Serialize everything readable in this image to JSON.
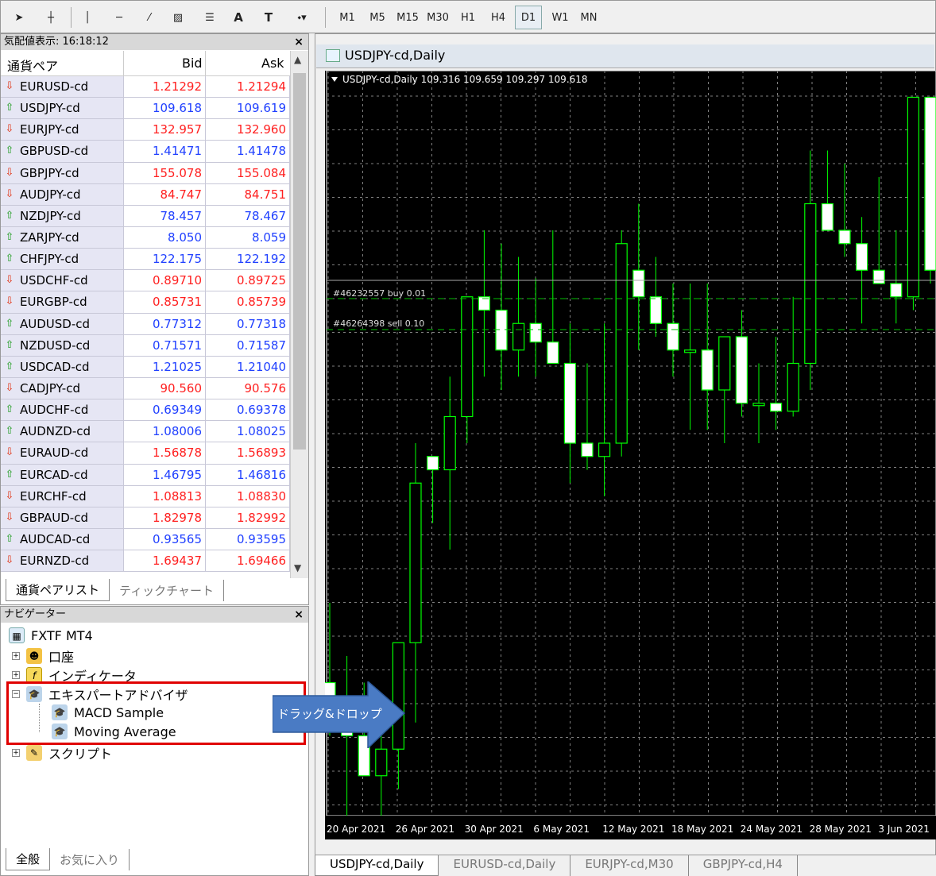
{
  "toolbar": {
    "items": [
      {
        "kind": "icon",
        "name": "cursor-icon",
        "glyph": "➤"
      },
      {
        "kind": "icon",
        "name": "crosshair-icon",
        "glyph": "┼"
      },
      {
        "kind": "icon",
        "name": "vertical-line-icon",
        "glyph": "│"
      },
      {
        "kind": "icon",
        "name": "horizontal-line-icon",
        "glyph": "─"
      },
      {
        "kind": "icon",
        "name": "trendline-icon",
        "glyph": "⁄"
      },
      {
        "kind": "icon",
        "name": "equidistant-channel-icon",
        "glyph": "▨"
      },
      {
        "kind": "icon",
        "name": "fibonacci-icon",
        "glyph": "☰"
      },
      {
        "kind": "text",
        "name": "text-tool-icon",
        "glyph": "A"
      },
      {
        "kind": "text",
        "name": "text-label-icon",
        "glyph": "T"
      },
      {
        "kind": "icon",
        "name": "arrows-dropdown-icon",
        "glyph": "⬩▾"
      }
    ],
    "periods": [
      "M1",
      "M5",
      "M15",
      "M30",
      "H1",
      "H4",
      "D1",
      "W1",
      "MN"
    ],
    "active_period": "D1"
  },
  "market_watch": {
    "title": "気配値表示: 16:18:12",
    "close": "×",
    "col_symbol": "通貨ペア",
    "col_bid": "Bid",
    "col_ask": "Ask",
    "rows": [
      {
        "s": "EURUSD-cd",
        "b": "1.21292",
        "a": "1.21294",
        "dir": "dn",
        "c": "red"
      },
      {
        "s": "USDJPY-cd",
        "b": "109.618",
        "a": "109.619",
        "dir": "up",
        "c": "blue"
      },
      {
        "s": "EURJPY-cd",
        "b": "132.957",
        "a": "132.960",
        "dir": "dn",
        "c": "red"
      },
      {
        "s": "GBPUSD-cd",
        "b": "1.41471",
        "a": "1.41478",
        "dir": "up",
        "c": "blue"
      },
      {
        "s": "GBPJPY-cd",
        "b": "155.078",
        "a": "155.084",
        "dir": "dn",
        "c": "red"
      },
      {
        "s": "AUDJPY-cd",
        "b": "84.747",
        "a": "84.751",
        "dir": "dn",
        "c": "red"
      },
      {
        "s": "NZDJPY-cd",
        "b": "78.457",
        "a": "78.467",
        "dir": "up",
        "c": "blue"
      },
      {
        "s": "ZARJPY-cd",
        "b": "8.050",
        "a": "8.059",
        "dir": "up",
        "c": "blue"
      },
      {
        "s": "CHFJPY-cd",
        "b": "122.175",
        "a": "122.192",
        "dir": "up",
        "c": "blue"
      },
      {
        "s": "USDCHF-cd",
        "b": "0.89710",
        "a": "0.89725",
        "dir": "dn",
        "c": "red"
      },
      {
        "s": "EURGBP-cd",
        "b": "0.85731",
        "a": "0.85739",
        "dir": "dn",
        "c": "red"
      },
      {
        "s": "AUDUSD-cd",
        "b": "0.77312",
        "a": "0.77318",
        "dir": "up",
        "c": "blue"
      },
      {
        "s": "NZDUSD-cd",
        "b": "0.71571",
        "a": "0.71587",
        "dir": "up",
        "c": "blue"
      },
      {
        "s": "USDCAD-cd",
        "b": "1.21025",
        "a": "1.21040",
        "dir": "up",
        "c": "blue"
      },
      {
        "s": "CADJPY-cd",
        "b": "90.560",
        "a": "90.576",
        "dir": "dn",
        "c": "red"
      },
      {
        "s": "AUDCHF-cd",
        "b": "0.69349",
        "a": "0.69378",
        "dir": "up",
        "c": "blue"
      },
      {
        "s": "AUDNZD-cd",
        "b": "1.08006",
        "a": "1.08025",
        "dir": "up",
        "c": "blue"
      },
      {
        "s": "EURAUD-cd",
        "b": "1.56878",
        "a": "1.56893",
        "dir": "dn",
        "c": "red"
      },
      {
        "s": "EURCAD-cd",
        "b": "1.46795",
        "a": "1.46816",
        "dir": "up",
        "c": "blue"
      },
      {
        "s": "EURCHF-cd",
        "b": "1.08813",
        "a": "1.08830",
        "dir": "dn",
        "c": "red"
      },
      {
        "s": "GBPAUD-cd",
        "b": "1.82978",
        "a": "1.82992",
        "dir": "dn",
        "c": "red"
      },
      {
        "s": "AUDCAD-cd",
        "b": "0.93565",
        "a": "0.93595",
        "dir": "up",
        "c": "blue"
      },
      {
        "s": "EURNZD-cd",
        "b": "1.69437",
        "a": "1.69466",
        "dir": "dn",
        "c": "red"
      }
    ],
    "tab_active": "通貨ペアリスト",
    "tab_other": "ティックチャート"
  },
  "navigator": {
    "title": "ナビゲーター",
    "close": "×",
    "root": "FXTF MT4",
    "account": "口座",
    "indicators": "インディケータ",
    "experts": "エキスパートアドバイザ",
    "ea1": "MACD Sample",
    "ea2": "Moving Average",
    "scripts": "スクリプト",
    "tab_active": "全般",
    "tab_other": "お気に入り"
  },
  "annotation": {
    "dnd_label": "ドラッグ&ドロップ"
  },
  "chart_window": {
    "title": "USDJPY-cd,Daily",
    "info_symbol": "USDJPY-cd,Daily",
    "info_ohlc": "109.316 109.659 109.297 109.618",
    "order1": "#46232557 buy 0.01",
    "order2": "#46264398 sell 0.10"
  },
  "chart_data": {
    "type": "candlestick",
    "dates": [
      "20 Apr 2021",
      "26 Apr 2021",
      "30 Apr 2021",
      "6 May 2021",
      "12 May 2021",
      "18 May 2021",
      "24 May 2021",
      "28 May 2021",
      "3 Jun 2021"
    ],
    "ylim": [
      107.6,
      110.4
    ],
    "candles": [
      [
        108.1,
        108.4,
        107.9,
        107.95
      ],
      [
        107.95,
        108.2,
        107.6,
        107.9
      ],
      [
        107.9,
        108.1,
        107.75,
        107.75
      ],
      [
        107.75,
        108.0,
        107.4,
        107.85
      ],
      [
        107.85,
        108.2,
        107.7,
        108.25
      ],
      [
        108.25,
        109.0,
        107.95,
        108.85
      ],
      [
        108.95,
        108.9,
        108.7,
        108.9
      ],
      [
        108.9,
        109.25,
        108.6,
        109.1
      ],
      [
        109.1,
        109.55,
        109.0,
        109.55
      ],
      [
        109.55,
        109.8,
        109.25,
        109.5
      ],
      [
        109.5,
        109.75,
        109.2,
        109.35
      ],
      [
        109.35,
        109.7,
        109.25,
        109.45
      ],
      [
        109.45,
        109.62,
        109.25,
        109.38
      ],
      [
        109.38,
        109.8,
        109.3,
        109.3
      ],
      [
        109.3,
        109.45,
        108.85,
        109.0
      ],
      [
        109.0,
        109.3,
        108.9,
        108.95
      ],
      [
        108.95,
        109.45,
        108.8,
        109.0
      ],
      [
        109.0,
        109.8,
        108.95,
        109.75
      ],
      [
        109.65,
        109.9,
        109.35,
        109.55
      ],
      [
        109.55,
        109.7,
        109.4,
        109.45
      ],
      [
        109.45,
        109.6,
        109.25,
        109.35
      ],
      [
        109.35,
        109.6,
        109.05,
        109.35
      ],
      [
        109.35,
        109.6,
        109.05,
        109.2
      ],
      [
        109.2,
        109.4,
        109.0,
        109.4
      ],
      [
        109.4,
        109.5,
        109.1,
        109.15
      ],
      [
        109.15,
        109.3,
        109.0,
        109.15
      ],
      [
        109.15,
        109.4,
        109.05,
        109.12
      ],
      [
        109.12,
        109.55,
        109.1,
        109.3
      ],
      [
        109.3,
        110.1,
        109.2,
        109.9
      ],
      [
        109.9,
        110.1,
        109.85,
        109.8
      ],
      [
        109.8,
        110.05,
        109.7,
        109.75
      ],
      [
        109.75,
        109.85,
        109.45,
        109.65
      ],
      [
        109.65,
        110.0,
        109.6,
        109.6
      ],
      [
        109.6,
        109.8,
        109.45,
        109.55
      ],
      [
        109.55,
        110.3,
        109.5,
        110.3
      ],
      [
        110.3,
        110.25,
        109.6,
        109.65
      ],
      [
        109.65,
        109.75,
        109.4,
        109.45
      ],
      [
        109.45,
        109.65,
        109.3,
        109.5
      ]
    ]
  }
}
